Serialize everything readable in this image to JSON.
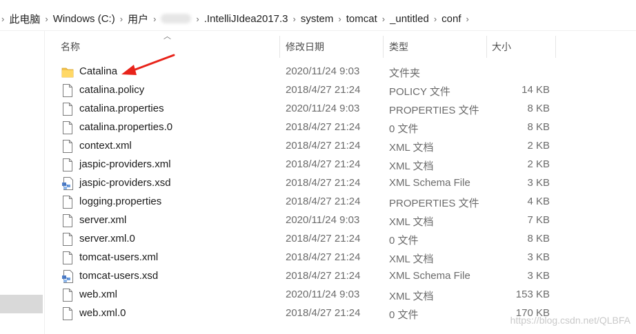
{
  "breadcrumb": {
    "items": [
      "此电脑",
      "Windows (C:)",
      "用户",
      ".IntelliJIdea2017.3",
      "system",
      "tomcat",
      "_untitled",
      "conf"
    ]
  },
  "columns": {
    "name": "名称",
    "date": "修改日期",
    "type": "类型",
    "size": "大小"
  },
  "files": [
    {
      "name": "Catalina",
      "date": "2020/11/24 9:03",
      "type": "文件夹",
      "size": "",
      "icon": "folder-icon"
    },
    {
      "name": "catalina.policy",
      "date": "2018/4/27 21:24",
      "type": "POLICY 文件",
      "size": "14 KB",
      "icon": "file-icon"
    },
    {
      "name": "catalina.properties",
      "date": "2020/11/24 9:03",
      "type": "PROPERTIES 文件",
      "size": "8 KB",
      "icon": "file-icon"
    },
    {
      "name": "catalina.properties.0",
      "date": "2018/4/27 21:24",
      "type": "0 文件",
      "size": "8 KB",
      "icon": "file-icon"
    },
    {
      "name": "context.xml",
      "date": "2018/4/27 21:24",
      "type": "XML 文档",
      "size": "2 KB",
      "icon": "file-icon"
    },
    {
      "name": "jaspic-providers.xml",
      "date": "2018/4/27 21:24",
      "type": "XML 文档",
      "size": "2 KB",
      "icon": "file-icon"
    },
    {
      "name": "jaspic-providers.xsd",
      "date": "2018/4/27 21:24",
      "type": "XML Schema File",
      "size": "3 KB",
      "icon": "xsd-file-icon"
    },
    {
      "name": "logging.properties",
      "date": "2018/4/27 21:24",
      "type": "PROPERTIES 文件",
      "size": "4 KB",
      "icon": "file-icon"
    },
    {
      "name": "server.xml",
      "date": "2020/11/24 9:03",
      "type": "XML 文档",
      "size": "7 KB",
      "icon": "file-icon"
    },
    {
      "name": "server.xml.0",
      "date": "2018/4/27 21:24",
      "type": "0 文件",
      "size": "8 KB",
      "icon": "file-icon"
    },
    {
      "name": "tomcat-users.xml",
      "date": "2018/4/27 21:24",
      "type": "XML 文档",
      "size": "3 KB",
      "icon": "file-icon"
    },
    {
      "name": "tomcat-users.xsd",
      "date": "2018/4/27 21:24",
      "type": "XML Schema File",
      "size": "3 KB",
      "icon": "xsd-file-icon"
    },
    {
      "name": "web.xml",
      "date": "2020/11/24 9:03",
      "type": "XML 文档",
      "size": "153 KB",
      "icon": "file-icon"
    },
    {
      "name": "web.xml.0",
      "date": "2018/4/27 21:24",
      "type": "0 文件",
      "size": "170 KB",
      "icon": "file-icon"
    }
  ],
  "annotation": {
    "color": "#e8231a",
    "icon": "red-arrow-icon"
  },
  "watermark": "https://blog.csdn.net/QLBFA"
}
